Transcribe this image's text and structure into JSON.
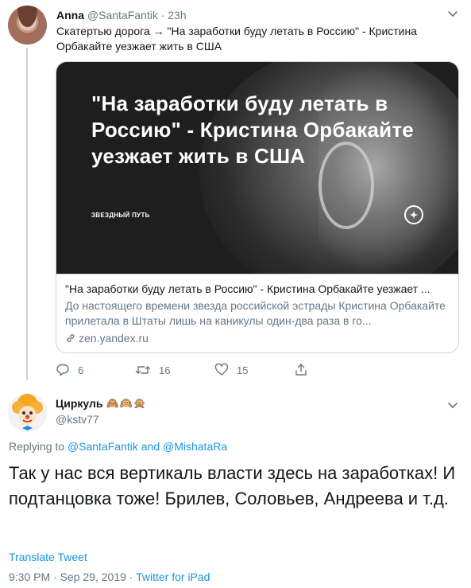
{
  "tweet1": {
    "name": "Anna",
    "handle": "@SantaFantik",
    "separator": "·",
    "time": "23h",
    "text": "Скатертью дорога → \"На заработки буду летать в Россию\" - Кристина Орбакайте уезжает жить в США",
    "card": {
      "headline": "\"На заработки буду летать в Россию\" - Кристина Орбакайте уезжает жить в США",
      "source_label": "ЗВЕЗДНЫЙ ПУТЬ",
      "title": "\"На заработки буду летать в Россию\" - Кристина Орбакайте уезжает ...",
      "description": "До настоящего времени звезда российской эстрады Кристина Орбакайте прилетала в Штаты лишь на каникулы один-два раза в го...",
      "domain": "zen.yandex.ru"
    },
    "actions": {
      "replies": "6",
      "retweets": "16",
      "likes": "15"
    }
  },
  "tweet2": {
    "name": "Циркуль",
    "name_emoji": "🙈🙉🙊",
    "handle": "@kstv77",
    "replying_prefix": "Replying to",
    "reply_user1": "@SantaFantik",
    "reply_and": "and",
    "reply_user2": "@MishataRa",
    "text": "Так у нас вся вертикаль власти здесь на заработках! И подтанцовка тоже! Брилев, Соловьев, Андреева и т.д.",
    "translate": "Translate Tweet",
    "time": "9:30 PM",
    "separator": "·",
    "date": "Sep 29, 2019",
    "client": "Twitter for iPad"
  },
  "colors": {
    "link": "#1b95e0",
    "secondary_text": "#657786",
    "border": "#ccd6dd"
  },
  "icons": [
    "chevron-down-icon",
    "reply-icon",
    "retweet-icon",
    "like-icon",
    "share-icon",
    "link-icon",
    "zen-icon"
  ]
}
